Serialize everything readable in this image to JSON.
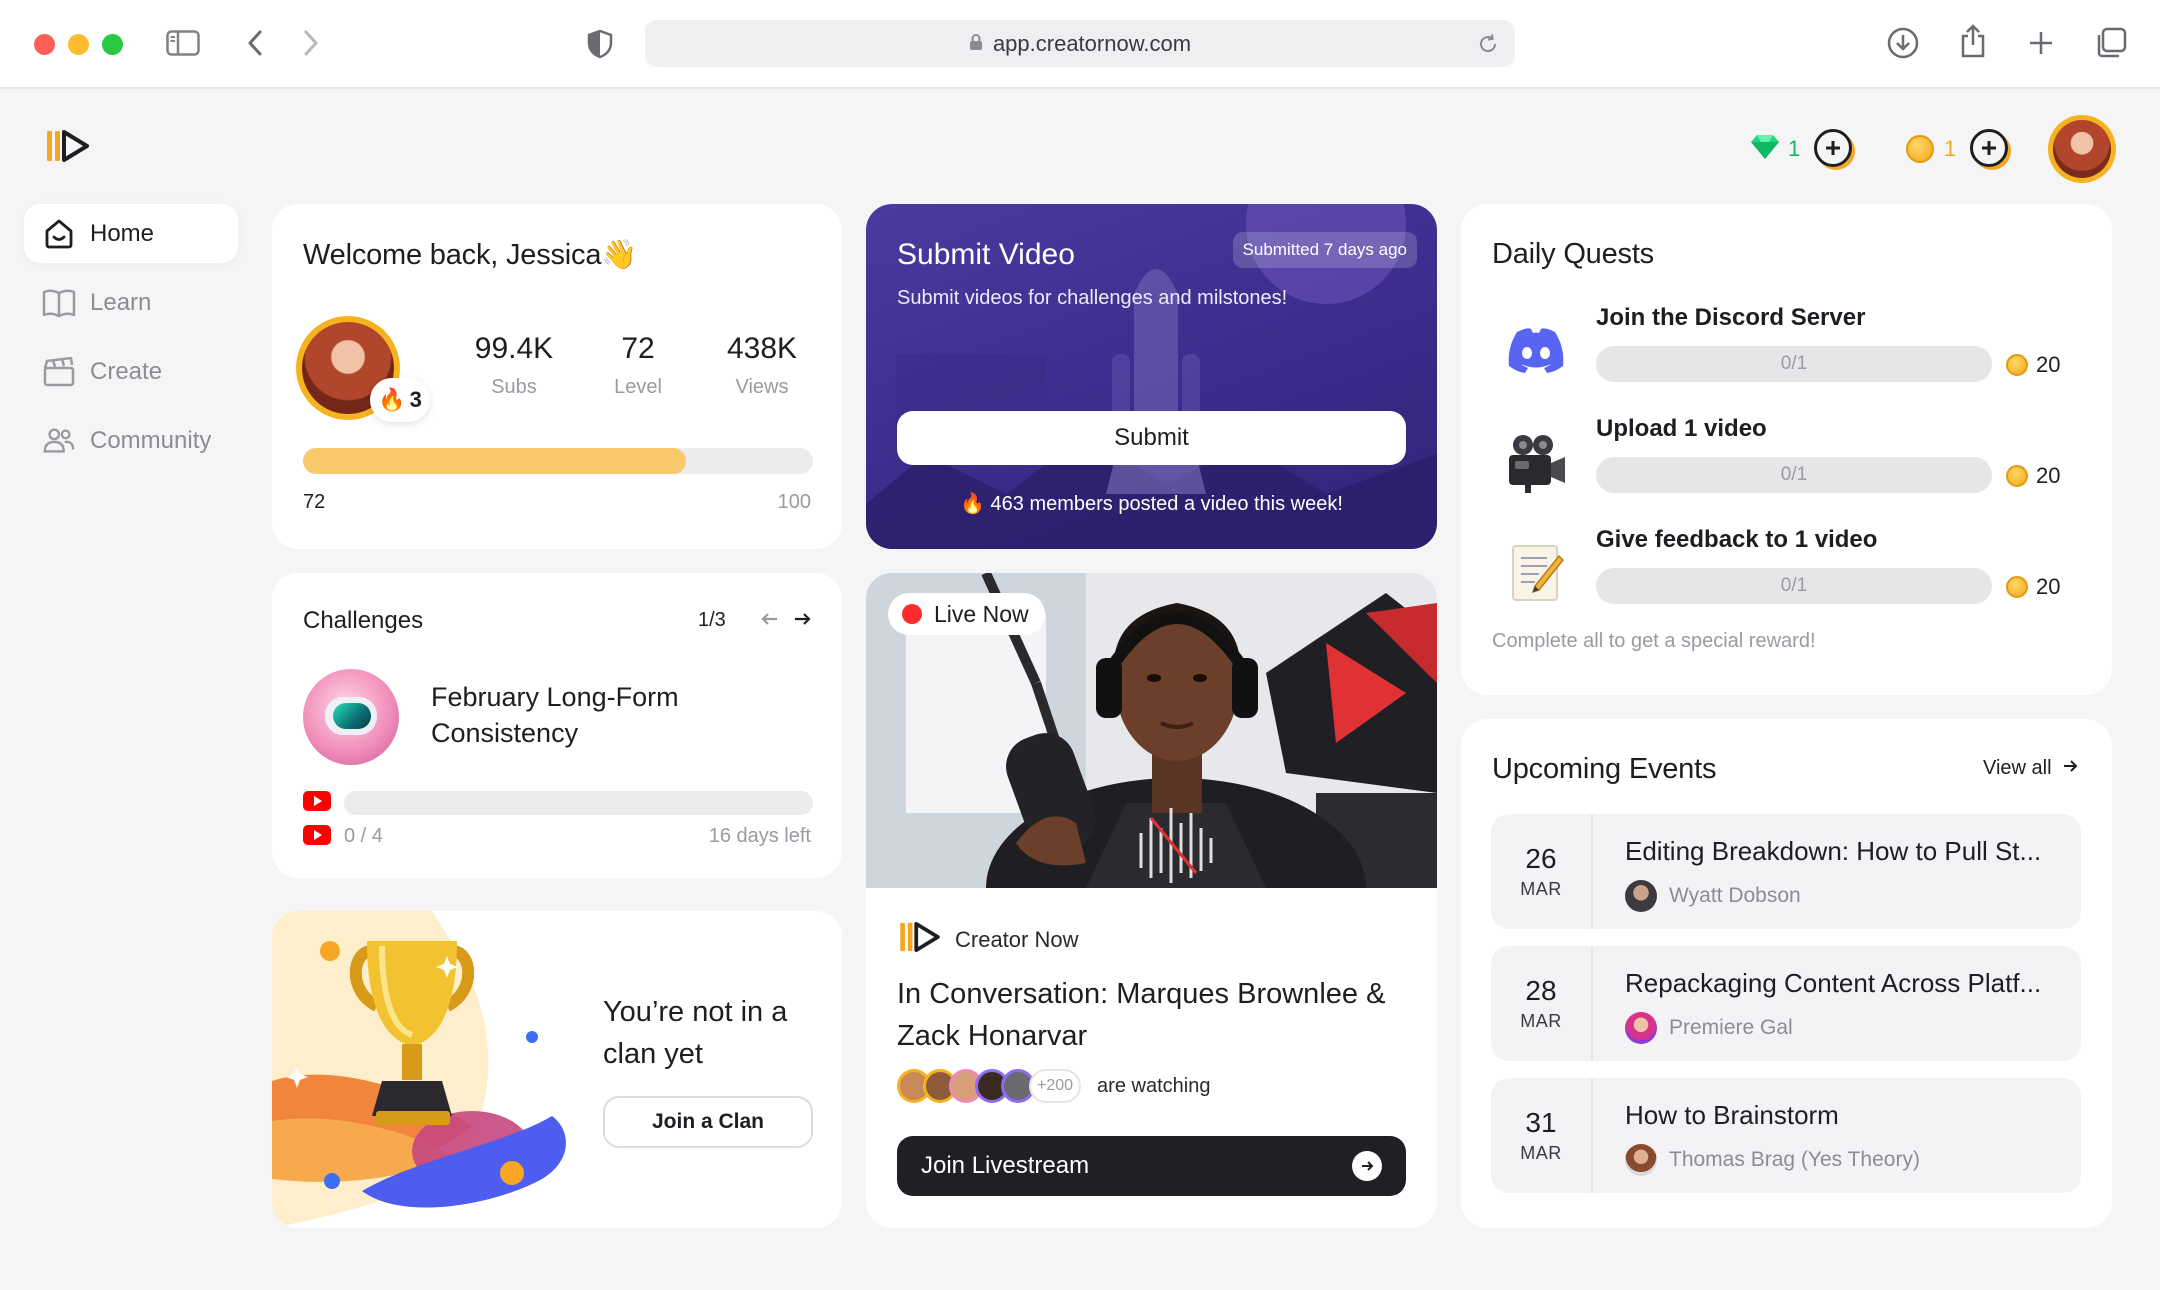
{
  "browser": {
    "url": "app.creatornow.com"
  },
  "topbar": {
    "gems": "1",
    "coins": "1"
  },
  "sidebar": {
    "items": [
      {
        "label": "Home"
      },
      {
        "label": "Learn"
      },
      {
        "label": "Create"
      },
      {
        "label": "Community"
      }
    ]
  },
  "welcome": {
    "title": "Welcome back, Jessica",
    "emoji": "👋",
    "streak": "3",
    "stats": [
      {
        "value": "99.4K",
        "label": "Subs"
      },
      {
        "value": "72",
        "label": "Level"
      },
      {
        "value": "438K",
        "label": "Views"
      }
    ],
    "progress_min": "72",
    "progress_max": "100",
    "progress_fraction": 0.75
  },
  "challenges": {
    "title": "Challenges",
    "pager": "1/3",
    "challenge_name": "February Long-Form Consistency",
    "progress": "0 / 4",
    "progress_fraction": 0,
    "days_left": "16 days left"
  },
  "clan": {
    "text": "You’re not in a clan yet",
    "button": "Join a Clan"
  },
  "submit_video": {
    "title": "Submit Video",
    "badge": "Submitted 7 days ago",
    "subtitle": "Submit videos for challenges and milstones!",
    "button": "Submit",
    "footer": "463 members posted a video this week!"
  },
  "live": {
    "badge": "Live Now",
    "channel": "Creator Now",
    "title": "In Conversation: Marques Brownlee & Zack Honarvar",
    "viewer_extra": "+200",
    "watching": "are watching",
    "button": "Join Livestream"
  },
  "quests": {
    "title": "Daily Quests",
    "items": [
      {
        "title": "Join the Discord Server",
        "progress": "0/1",
        "reward": "20",
        "icon": "discord-icon"
      },
      {
        "title": "Upload 1 video",
        "progress": "0/1",
        "reward": "20",
        "icon": "camera-icon"
      },
      {
        "title": "Give feedback to 1 video",
        "progress": "0/1",
        "reward": "20",
        "icon": "memo-icon"
      }
    ],
    "footer": "Complete all to get a special reward!"
  },
  "events": {
    "title": "Upcoming Events",
    "view_all": "View all",
    "items": [
      {
        "day": "26",
        "month": "MAR",
        "title": "Editing Breakdown: How to Pull St...",
        "host": "Wyatt Dobson"
      },
      {
        "day": "28",
        "month": "MAR",
        "title": "Repackaging Content Across Platf...",
        "host": "Premiere Gal"
      },
      {
        "day": "31",
        "month": "MAR",
        "title": "How to Brainstorm",
        "host": "Thomas Brag (Yes Theory)"
      }
    ]
  },
  "colors": {
    "accent_orange": "#f6a623",
    "purple_card": "#3d2f8f",
    "dark_button": "#1f1f24",
    "live_red": "#ff2b2b",
    "youtube_red": "#ff0000"
  }
}
